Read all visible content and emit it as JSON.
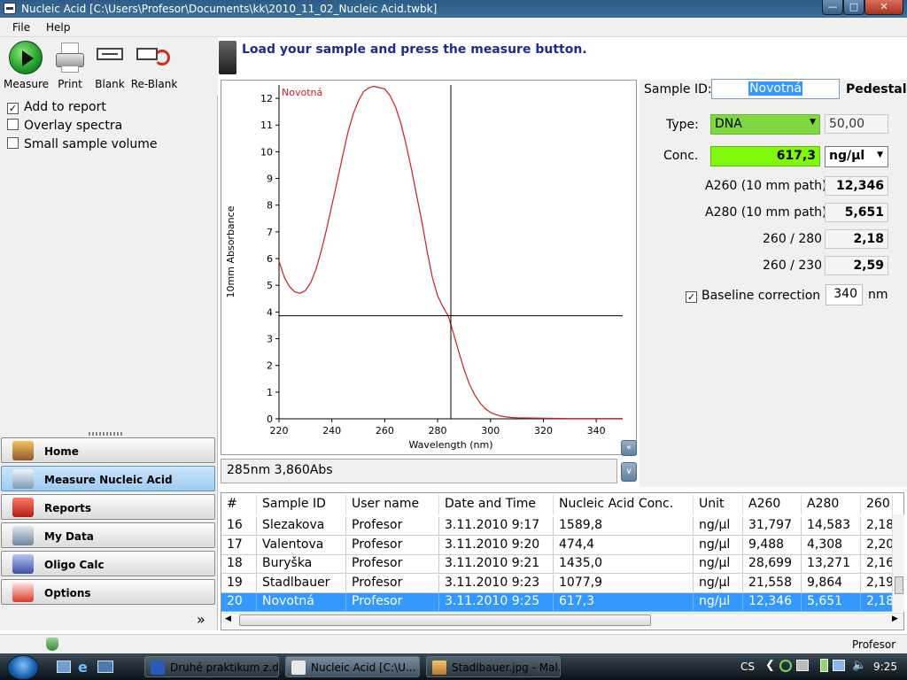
{
  "window": {
    "title": "Nucleic Acid  [C:\\Users\\Profesor\\Documents\\kk\\2010_11_02_Nucleic Acid.twbk]"
  },
  "menu": {
    "items": [
      "File",
      "Help"
    ]
  },
  "toolbar": {
    "measure": "Measure",
    "print": "Print",
    "blank": "Blank",
    "reblank": "Re-Blank"
  },
  "options": {
    "add_to_report": "Add to report",
    "overlay_spectra": "Overlay spectra",
    "small_sample_volume": "Small sample volume"
  },
  "nav": {
    "items": [
      "Home",
      "Measure Nucleic Acid",
      "Reports",
      "My Data",
      "Oligo Calc",
      "Options"
    ],
    "more": "»"
  },
  "hint": "Load your sample and press the measure button.",
  "chart_data": {
    "type": "line",
    "series_label": "Novotná",
    "xlabel": "Wavelength (nm)",
    "ylabel": "10mm Absorbance",
    "xlim": [
      220,
      350
    ],
    "ylim": [
      0,
      12.5
    ],
    "xticks": [
      220,
      240,
      260,
      280,
      300,
      320,
      340
    ],
    "yticks": [
      0,
      1,
      2,
      3,
      4,
      5,
      6,
      7,
      8,
      9,
      10,
      11,
      12
    ],
    "series": [
      {
        "x": [
          220,
          222,
          224,
          226,
          228,
          230,
          232,
          234,
          236,
          238,
          240,
          242,
          244,
          246,
          248,
          250,
          252,
          254,
          256,
          258,
          260,
          262,
          264,
          266,
          268,
          270,
          272,
          274,
          276,
          278,
          280,
          282,
          284,
          286,
          288,
          290,
          292,
          294,
          296,
          298,
          300,
          302,
          304,
          306,
          308,
          310,
          315,
          320,
          330,
          340,
          350
        ],
        "y": [
          5.9,
          5.3,
          4.95,
          4.75,
          4.7,
          4.8,
          5.1,
          5.6,
          6.3,
          7.1,
          8.0,
          8.9,
          9.8,
          10.7,
          11.4,
          11.9,
          12.25,
          12.4,
          12.45,
          12.4,
          12.35,
          12.1,
          11.7,
          11.1,
          10.3,
          9.4,
          8.4,
          7.4,
          6.3,
          5.3,
          4.6,
          4.2,
          3.86,
          3.2,
          2.5,
          1.85,
          1.3,
          0.9,
          0.6,
          0.38,
          0.24,
          0.16,
          0.1,
          0.07,
          0.05,
          0.04,
          0.03,
          0.02,
          0.01,
          0.01,
          0.01
        ],
        "color": "#cc1f1f"
      }
    ],
    "cursor": {
      "x": 285,
      "y": 3.86
    }
  },
  "readout": "285nm 3,860Abs",
  "results": {
    "sample_id_label": "Sample ID:",
    "sample_id": "Novotná",
    "mode": "Pedestal",
    "type_label": "Type:",
    "type_value": "DNA",
    "type_factor": "50,00",
    "conc_label": "Conc.",
    "conc_value": "617,3",
    "unit": "ng/µl",
    "a260_label": "A260 (10 mm path)",
    "a260": "12,346",
    "a280_label": "A280 (10 mm path)",
    "a280": "5,651",
    "r260_280_label": "260 / 280",
    "r260_280": "2,18",
    "r260_230_label": "260 / 230",
    "r260_230": "2,59",
    "baseline_label": "Baseline correction",
    "baseline_value": "340",
    "baseline_unit": "nm"
  },
  "table": {
    "headers": [
      "#",
      "Sample ID",
      "User name",
      "Date and Time",
      "Nucleic Acid Conc.",
      "Unit",
      "A260",
      "A280",
      "260"
    ],
    "rows": [
      [
        "16",
        "Slezakova",
        "Profesor",
        "3.11.2010 9:17",
        "1589,8",
        "ng/µl",
        "31,797",
        "14,583",
        "2,18"
      ],
      [
        "17",
        "Valentova",
        "Profesor",
        "3.11.2010 9:20",
        "474,4",
        "ng/µl",
        "9,488",
        "4,308",
        "2,20"
      ],
      [
        "18",
        "Buryška",
        "Profesor",
        "3.11.2010 9:21",
        "1435,0",
        "ng/µl",
        "28,699",
        "13,271",
        "2,16"
      ],
      [
        "19",
        "Stadlbauer",
        "Profesor",
        "3.11.2010 9:23",
        "1077,9",
        "ng/µl",
        "21,558",
        "9,864",
        "2,19"
      ],
      [
        "20",
        "Novotná",
        "Profesor",
        "3.11.2010 9:25",
        "617,3",
        "ng/µl",
        "12,346",
        "5,651",
        "2,18"
      ]
    ],
    "selected_row": 4
  },
  "status": {
    "user": "Profesor"
  },
  "taskbar": {
    "tasks": [
      "Druhé praktikum z.d...",
      "Nucleic Acid  [C:\\U...",
      "Stadlbauer.jpg - Mal..."
    ],
    "language": "CS",
    "time": "9:25"
  }
}
